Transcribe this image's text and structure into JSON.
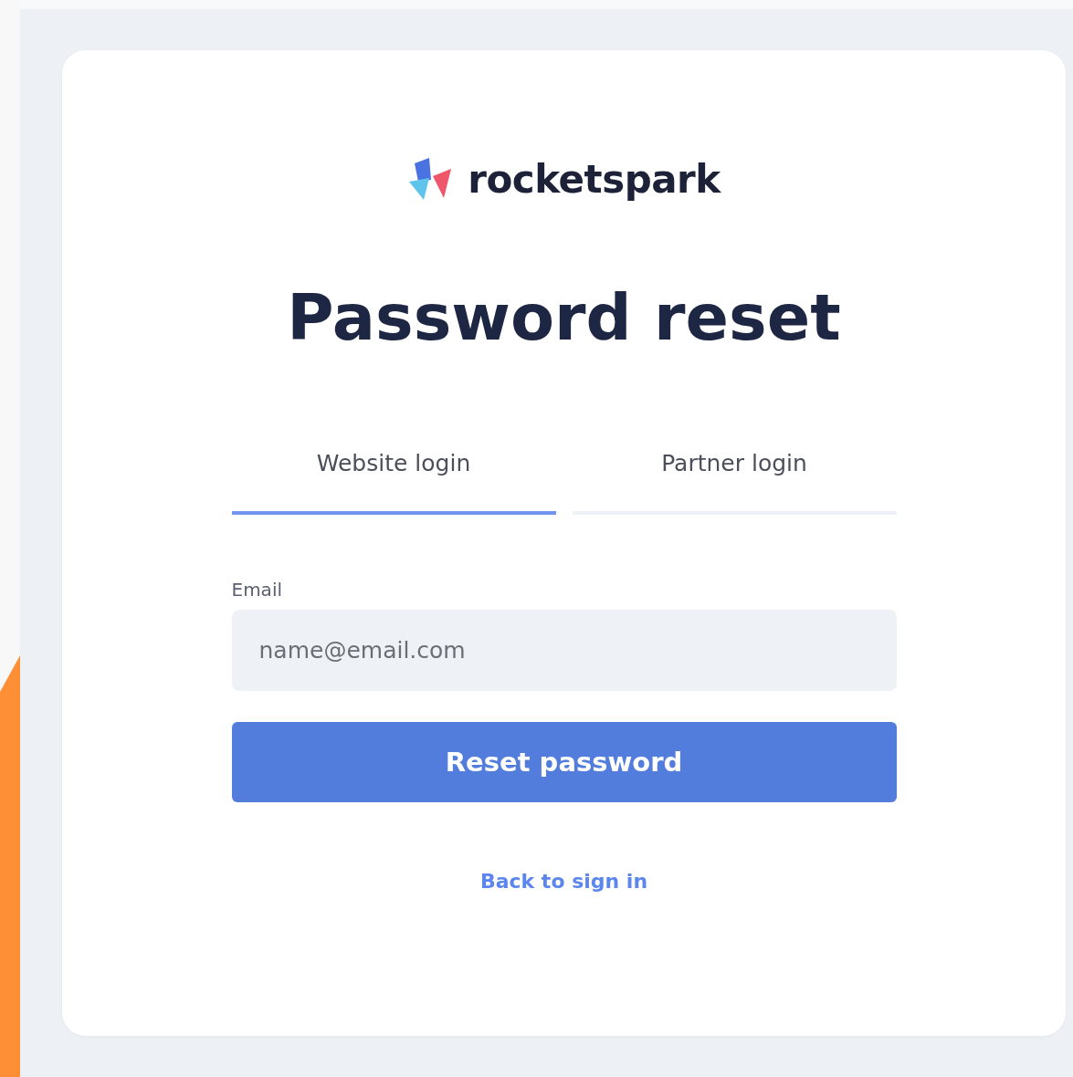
{
  "logo": {
    "text": "rocketspark"
  },
  "title": "Password reset",
  "tabs": [
    {
      "label": "Website login",
      "selected": true
    },
    {
      "label": "Partner login",
      "selected": false
    }
  ],
  "email_field": {
    "label": "Email",
    "placeholder": "name@email.com"
  },
  "submit_button": "Reset password",
  "back_link": "Back to sign in"
}
